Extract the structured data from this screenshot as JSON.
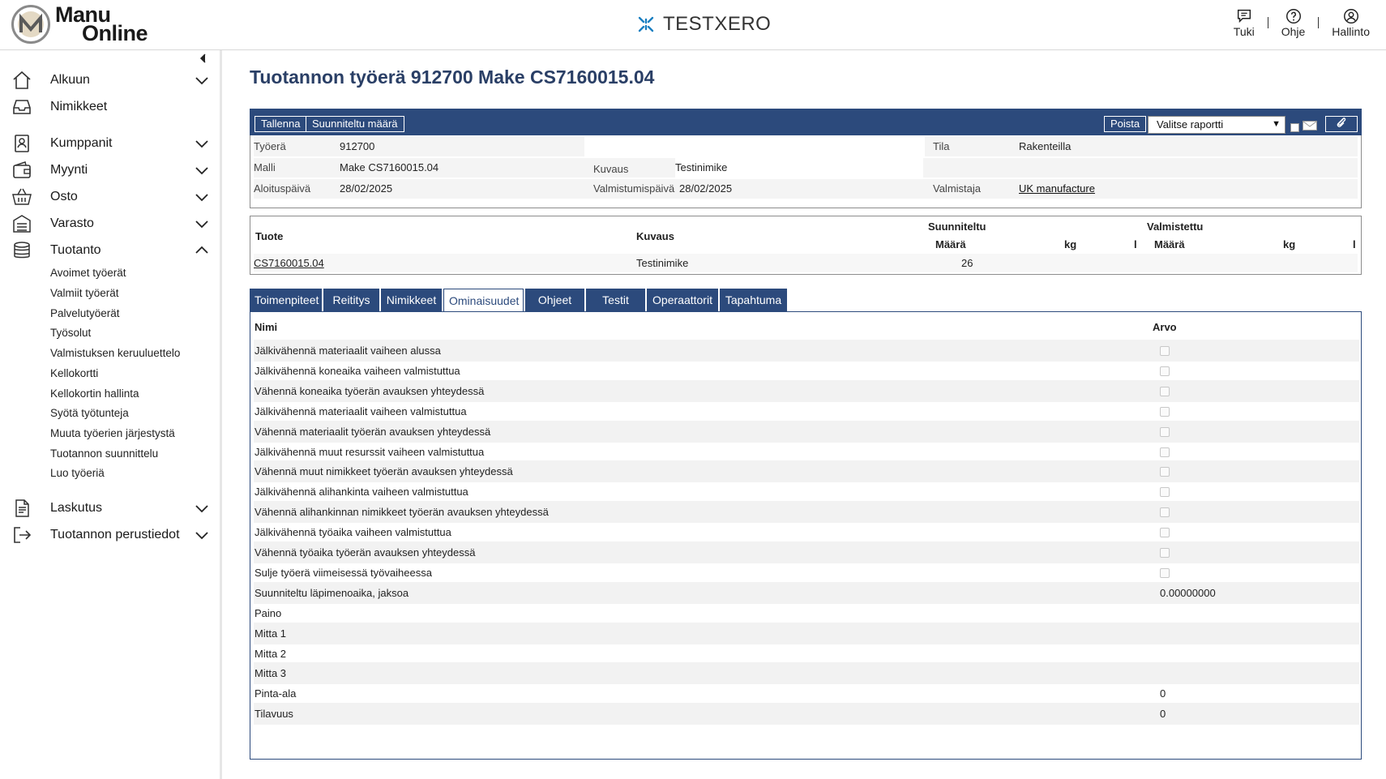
{
  "header": {
    "logo_line1": "Manu",
    "logo_line2": "Online",
    "company": "TESTXERO",
    "actions": [
      {
        "label": "Tuki",
        "icon": "chat-icon"
      },
      {
        "label": "Ohje",
        "icon": "help-icon"
      },
      {
        "label": "Hallinto",
        "icon": "user-icon"
      }
    ],
    "separator": "|"
  },
  "sidebar": {
    "collapse_icon": "chevron-left-icon",
    "items": [
      {
        "label": "Alkuun",
        "icon": "home-icon",
        "expandable": true
      },
      {
        "label": "Nimikkeet",
        "icon": "inbox-icon",
        "expandable": false
      },
      {
        "label": "Kumppanit",
        "icon": "contacts-icon",
        "expandable": true
      },
      {
        "label": "Myynti",
        "icon": "wallet-icon",
        "expandable": true
      },
      {
        "label": "Osto",
        "icon": "basket-icon",
        "expandable": true
      },
      {
        "label": "Varasto",
        "icon": "warehouse-icon",
        "expandable": true
      },
      {
        "label": "Tuotanto",
        "icon": "database-icon",
        "expandable": true,
        "expanded": true
      },
      {
        "label": "Laskutus",
        "icon": "document-icon",
        "expandable": true
      },
      {
        "label": "Tuotannon perustiedot",
        "icon": "exit-icon",
        "expandable": true
      }
    ],
    "subitems": [
      "Avoimet työerät",
      "Valmiit työerät",
      "Palvelutyöerät",
      "Työsolut",
      "Valmistuksen keruuluettelo",
      "Kellokortti",
      "Kellokortin hallinta",
      "Syötä työtunteja",
      "Muuta työerien järjestystä",
      "Tuotannon suunnittelu",
      "Luo työeriä"
    ]
  },
  "main": {
    "title": "Tuotannon työerä 912700 Make CS7160015.04",
    "toolbar": {
      "save_label": "Tallenna",
      "planned_qty_label": "Suunniteltu määrä",
      "delete_label": "Poista",
      "report_placeholder": "Valitse raportti",
      "attach_icon": "paperclip-icon",
      "mail_icon": "mail-icon"
    },
    "info": {
      "batch_label": "Työerä",
      "batch_value": "912700",
      "status_label": "Tila",
      "status_value": "Rakenteilla",
      "model_label": "Malli",
      "model_value": "Make CS7160015.04",
      "desc_label": "Kuvaus",
      "desc_value": "Testinimike",
      "start_label": "Aloituspäivä",
      "start_value": "28/02/2025",
      "finish_label": "Valmistumispäivä",
      "finish_value": "28/02/2025",
      "maker_label": "Valmistaja",
      "maker_value": "UK manufacture"
    },
    "product_table": {
      "col_product": "Tuote",
      "col_desc": "Kuvaus",
      "group_planned": "Suunniteltu",
      "group_made": "Valmistettu",
      "col_qty": "Määrä",
      "col_kg": "kg",
      "col_l": "l",
      "rows": [
        {
          "product": "CS7160015.04",
          "desc": "Testinimike",
          "planned_qty": "26"
        }
      ]
    },
    "tabs": [
      {
        "label": "Toimenpiteet",
        "active": false
      },
      {
        "label": "Reititys",
        "active": false
      },
      {
        "label": "Nimikkeet",
        "active": false
      },
      {
        "label": "Ominaisuudet",
        "active": true
      },
      {
        "label": "Ohjeet",
        "active": false
      },
      {
        "label": "Testit",
        "active": false
      },
      {
        "label": "Operaattorit",
        "active": false
      },
      {
        "label": "Tapahtuma",
        "active": false
      }
    ],
    "properties": {
      "col_name": "Nimi",
      "col_value": "Arvo",
      "rows": [
        {
          "name": "Jälkivähennä materiaalit vaiheen alussa",
          "type": "checkbox",
          "value": false
        },
        {
          "name": "Jälkivähennä koneaika vaiheen valmistuttua",
          "type": "checkbox",
          "value": false
        },
        {
          "name": "Vähennä koneaika työerän avauksen yhteydessä",
          "type": "checkbox",
          "value": false
        },
        {
          "name": "Jälkivähennä materiaalit vaiheen valmistuttua",
          "type": "checkbox",
          "value": false
        },
        {
          "name": "Vähennä materiaalit työerän avauksen yhteydessä",
          "type": "checkbox",
          "value": false
        },
        {
          "name": "Jälkivähennä muut resurssit vaiheen valmistuttua",
          "type": "checkbox",
          "value": false
        },
        {
          "name": "Vähennä muut nimikkeet työerän avauksen yhteydessä",
          "type": "checkbox",
          "value": false
        },
        {
          "name": "Jälkivähennä alihankinta vaiheen valmistuttua",
          "type": "checkbox",
          "value": false
        },
        {
          "name": "Vähennä alihankinnan nimikkeet työerän avauksen yhteydessä",
          "type": "checkbox",
          "value": false
        },
        {
          "name": "Jälkivähennä työaika vaiheen valmistuttua",
          "type": "checkbox",
          "value": false
        },
        {
          "name": "Vähennä työaika työerän avauksen yhteydessä",
          "type": "checkbox",
          "value": false
        },
        {
          "name": "Sulje työerä viimeisessä työvaiheessa",
          "type": "checkbox",
          "value": false
        },
        {
          "name": "Suunniteltu läpimenoaika, jaksoa",
          "type": "text",
          "value": "0.00000000"
        },
        {
          "name": "Paino",
          "type": "text",
          "value": ""
        },
        {
          "name": "Mitta 1",
          "type": "text",
          "value": ""
        },
        {
          "name": "Mitta 2",
          "type": "text",
          "value": ""
        },
        {
          "name": "Mitta 3",
          "type": "text",
          "value": ""
        },
        {
          "name": "Pinta-ala",
          "type": "text",
          "value": "0"
        },
        {
          "name": "Tilavuus",
          "type": "text",
          "value": "0"
        }
      ]
    }
  },
  "colors": {
    "primary": "#2c4a7c",
    "title": "#2a3f66",
    "row_shade": "#f2f2f2",
    "brand_accent": "#1a7fc1"
  }
}
